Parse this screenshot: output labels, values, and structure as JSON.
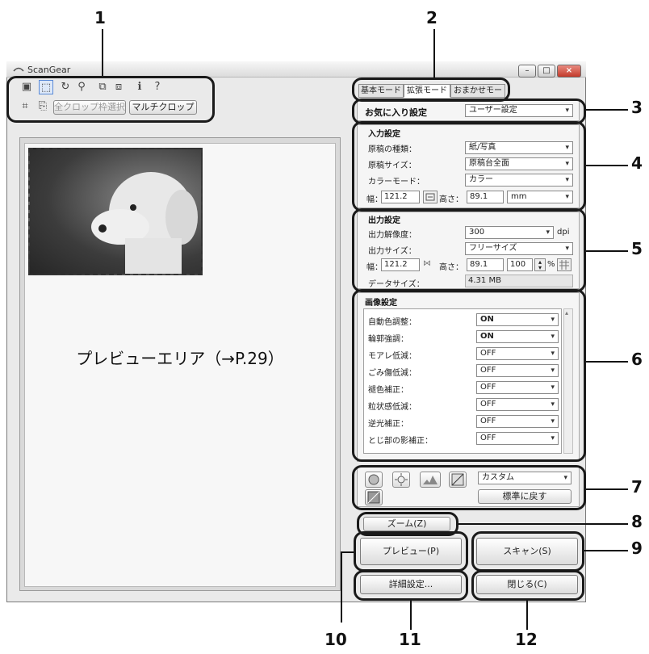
{
  "callouts": [
    "1",
    "2",
    "3",
    "4",
    "5",
    "6",
    "7",
    "8",
    "9",
    "10",
    "11",
    "12"
  ],
  "window": {
    "title": "ScanGear",
    "controls": {
      "minimize": "–",
      "maximize": "□",
      "close": "×"
    }
  },
  "toolbar": {
    "icons": [
      "thumbnail-icon",
      "crop-select-icon",
      "rotate-icon",
      "zoom-icon",
      "copy-icon",
      "paste-icon",
      "info-icon",
      "help-icon"
    ],
    "icon_glyphs": [
      "▣",
      "⬚",
      "↻",
      "⚲",
      "⧉",
      "⧈",
      "ℹ",
      "?"
    ],
    "row2_icons": [
      "auto-crop-icon",
      "clear-crop-icon"
    ],
    "row2_glyphs": [
      "⌗",
      "⎘"
    ],
    "select_all_crops_label": "全クロップ枠選択",
    "multi_crop_label": "マルチクロップ"
  },
  "preview": {
    "label": "プレビューエリア（→P.29）"
  },
  "tabs": [
    "基本モード",
    "拡張モード",
    "おまかせモード"
  ],
  "favorites": {
    "label": "お気に入り設定",
    "value": "ユーザー設定"
  },
  "input_settings": {
    "title": "入力設定",
    "doc_type_label": "原稿の種類：",
    "doc_type_value": "紙/写真",
    "doc_size_label": "原稿サイズ：",
    "doc_size_value": "原稿台全面",
    "color_mode_label": "カラーモード：",
    "color_mode_value": "カラー",
    "width_label": "幅：",
    "width_value": "121.2",
    "height_label": "高さ：",
    "height_value": "89.1",
    "unit_value": "mm"
  },
  "output_settings": {
    "title": "出力設定",
    "resolution_label": "出力解像度：",
    "resolution_value": "300",
    "resolution_unit": "dpi",
    "size_label": "出力サイズ：",
    "size_value": "フリーサイズ",
    "width_label": "幅：",
    "width_value": "121.2",
    "height_label": "高さ：",
    "height_value": "89.1",
    "scale_value": "100",
    "scale_unit": "%",
    "data_size_label": "データサイズ：",
    "data_size_value": "4.31 MB"
  },
  "image_settings": {
    "title": "画像設定",
    "rows": [
      {
        "label": "自動色調整：",
        "value": "ON"
      },
      {
        "label": "輪郭強調：",
        "value": "ON"
      },
      {
        "label": "モアレ低減：",
        "value": "OFF"
      },
      {
        "label": "ごみ傷低減：",
        "value": "OFF"
      },
      {
        "label": "褪色補正：",
        "value": "OFF"
      },
      {
        "label": "粒状感低減：",
        "value": "OFF"
      },
      {
        "label": "逆光補正：",
        "value": "OFF"
      },
      {
        "label": "とじ部の影補正：",
        "value": "OFF"
      }
    ]
  },
  "adjust": {
    "preset_value": "カスタム",
    "reset_label": "標準に戻す"
  },
  "buttons": {
    "zoom": "ズーム(Z)",
    "preview": "プレビュー(P)",
    "scan": "スキャン(S)",
    "details": "詳細設定...",
    "close": "閉じる(C)"
  }
}
